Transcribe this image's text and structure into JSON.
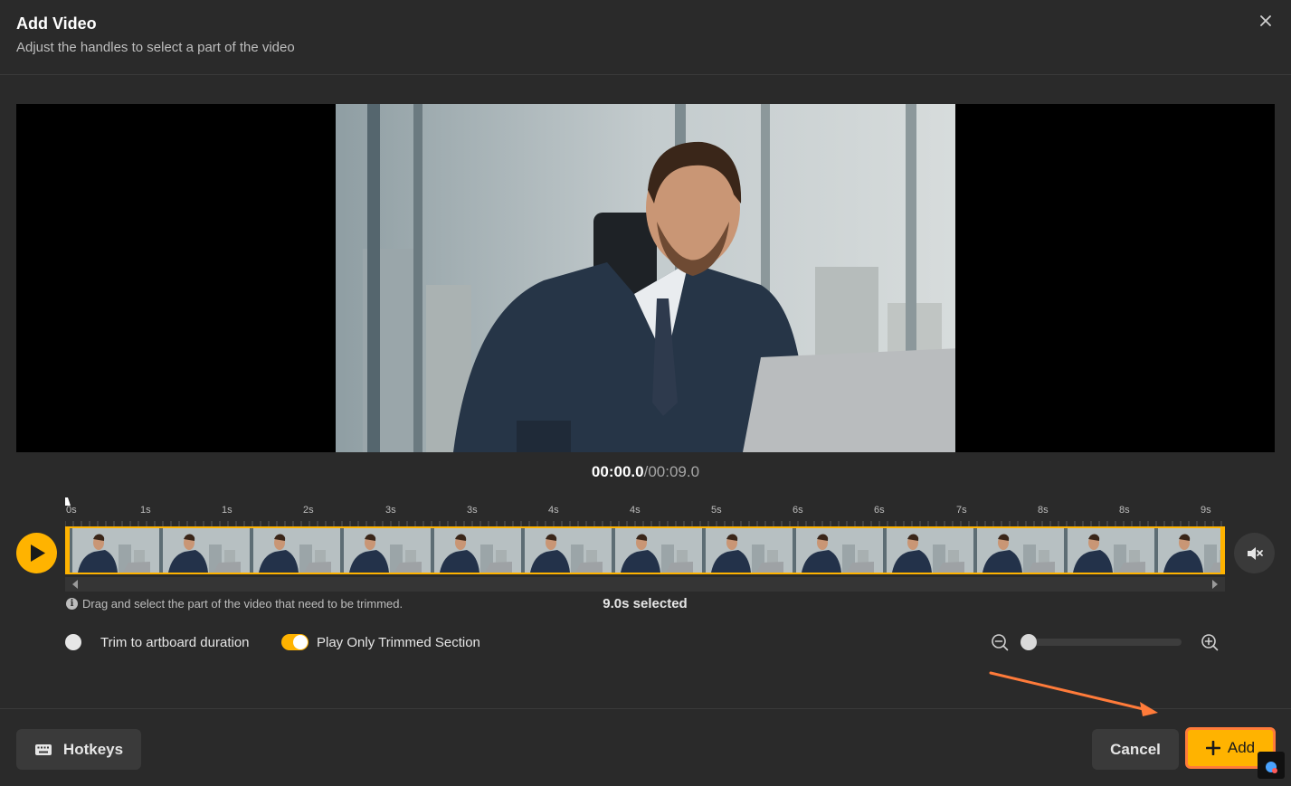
{
  "header": {
    "title": "Add Video",
    "subtitle": "Adjust the handles to select a part of the video"
  },
  "player": {
    "current_time": "00:00.0",
    "separator": "/",
    "total_time": "00:09.0"
  },
  "timeline": {
    "ticks": [
      "0s",
      "1s",
      "1s",
      "2s",
      "3s",
      "3s",
      "4s",
      "4s",
      "5s",
      "6s",
      "6s",
      "7s",
      "8s",
      "8s",
      "9s"
    ],
    "thumbnail_count": 13,
    "hint": "Drag and select the part of the video that need to be trimmed.",
    "selected_label": "9.0s selected"
  },
  "options": {
    "trim_to_artboard": {
      "label": "Trim to artboard duration",
      "on": false
    },
    "play_only_trimmed": {
      "label": "Play Only Trimmed Section",
      "on": true
    }
  },
  "zoom": {
    "level": 0
  },
  "footer": {
    "hotkeys_label": "Hotkeys",
    "cancel_label": "Cancel",
    "add_label": "Add"
  },
  "colors": {
    "accent": "#ffb300",
    "annotation_arrow": "#ff7b3a",
    "background": "#2a2a2a"
  }
}
